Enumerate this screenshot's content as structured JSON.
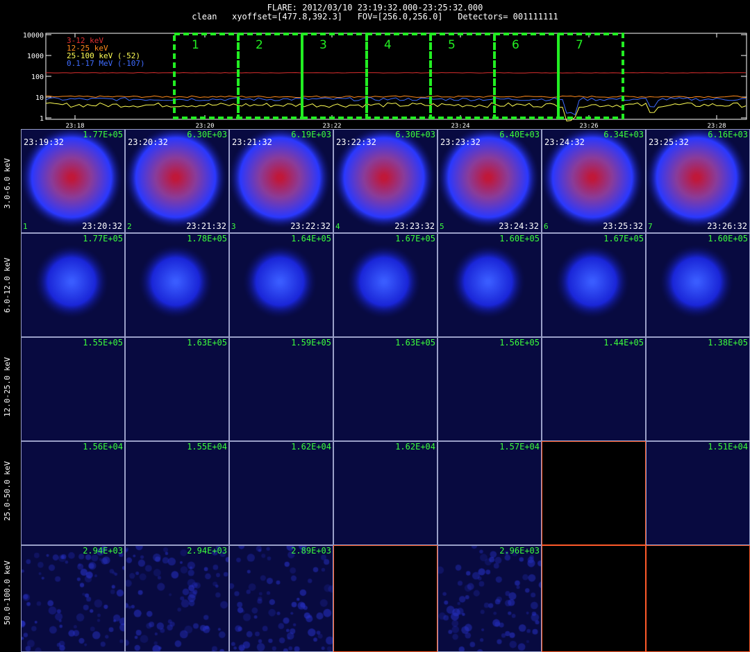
{
  "header": {
    "title": "FLARE: 2012/03/10 23:19:32.000-23:25:32.000",
    "subtitle": "clean   xyoffset=[477.8,392.3]   FOV=[256.0,256.0]   Detectors= 001111111"
  },
  "lightcurve": {
    "y_ticks": [
      "10000",
      "1000",
      "100",
      "10",
      "1"
    ],
    "x_ticks": [
      "23:18",
      "23:20",
      "23:22",
      "23:24",
      "23:26",
      "23:28"
    ],
    "legend": [
      {
        "label": "3-12 keV",
        "color": "#e03030"
      },
      {
        "label": "12-25 keV",
        "color": "#ff8a1c"
      },
      {
        "label": "25-100 keV (-52)",
        "color": "#ffff55"
      },
      {
        "label": "0.1-17 MeV (-107)",
        "color": "#3f6cff"
      }
    ],
    "intervals": [
      "1",
      "2",
      "3",
      "4",
      "5",
      "6",
      "7"
    ],
    "interval_color": "#22ee22"
  },
  "rows": [
    {
      "band": "3.0-6.0 keV",
      "peaks": [
        "1.77E+05",
        "6.30E+03",
        "6.19E+03",
        "6.30E+03",
        "6.40E+03",
        "6.34E+03",
        "6.16E+03"
      ],
      "mode": "hot"
    },
    {
      "band": "6.0-12.0 keV",
      "peaks": [
        "1.77E+05",
        "1.78E+05",
        "1.64E+05",
        "1.67E+05",
        "1.60E+05",
        "1.67E+05",
        "1.60E+05"
      ],
      "mode": "blue"
    },
    {
      "band": "12.0-25.0 keV",
      "peaks": [
        "1.55E+05",
        "1.63E+05",
        "1.59E+05",
        "1.63E+05",
        "1.56E+05",
        "1.44E+05",
        "1.38E+05"
      ],
      "mode": "flat"
    },
    {
      "band": "25.0-50.0 keV",
      "peaks": [
        "1.56E+04",
        "1.55E+04",
        "1.62E+04",
        "1.62E+04",
        "1.57E+04",
        "",
        "1.51E+04"
      ],
      "mode": "flat"
    },
    {
      "band": "50.0-100.0 keV",
      "peaks": [
        "2.94E+03",
        "2.94E+03",
        "2.89E+03",
        "",
        "2.96E+03",
        "",
        ""
      ],
      "mode": "noise"
    }
  ],
  "start_times": [
    "23:19:32",
    "23:20:32",
    "23:21:32",
    "23:22:32",
    "23:23:32",
    "23:24:32",
    "23:25:32"
  ],
  "end_times": [
    "23:20:32",
    "23:21:32",
    "23:22:32",
    "23:23:32",
    "23:24:32",
    "23:25:32",
    "23:26:32"
  ],
  "frame_index": [
    "1",
    "2",
    "3",
    "4",
    "5",
    "6",
    "7"
  ]
}
